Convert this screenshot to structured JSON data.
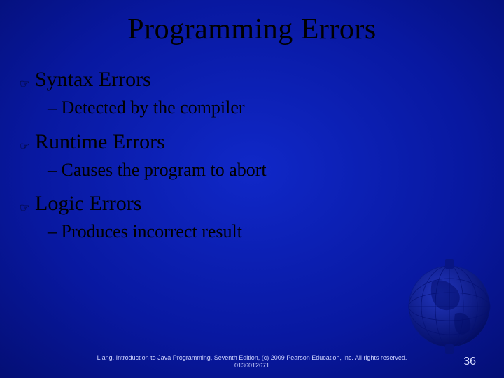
{
  "title": "Programming Errors",
  "bullets": [
    {
      "label": "Syntax Errors",
      "sub": "Detected by the compiler"
    },
    {
      "label": "Runtime Errors",
      "sub": "Causes the program to abort"
    },
    {
      "label": "Logic Errors",
      "sub": "Produces incorrect result"
    }
  ],
  "footer": "Liang, Introduction to Java Programming, Seventh Edition, (c) 2009 Pearson Education, Inc. All rights reserved. 0136012671",
  "page_number": "36",
  "icons": {
    "pointer": "☞"
  },
  "dash": "–"
}
